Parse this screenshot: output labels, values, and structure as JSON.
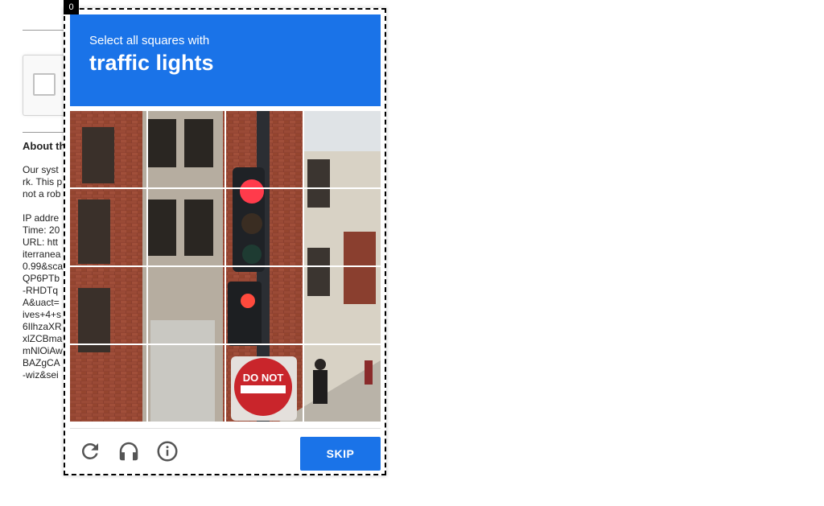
{
  "background": {
    "about_heading": "About th",
    "paragraph_lines": [
      "Our syst",
      "rk. This p",
      "not a rob"
    ],
    "details_lines": [
      "IP addre",
      "Time: 20",
      "URL: htt",
      "iterranea",
      "0.99&sca",
      "QP6PTb",
      "-RHDTq",
      "A&uact=",
      "ives+4+s",
      "6IlhzaXR",
      "xlZCBma",
      "mNlOiAw",
      "BAZgCA",
      "-wiz&sei"
    ]
  },
  "frame_index": "0",
  "challenge": {
    "instruction": "Select all squares with",
    "target_object": "traffic lights",
    "grid_rows": 4,
    "grid_cols": 4,
    "sign_text": "DO NOT",
    "skip_label": "SKIP",
    "accent_color": "#1a73e8",
    "icons": [
      "reload-icon",
      "audio-headphones-icon",
      "info-icon"
    ]
  }
}
